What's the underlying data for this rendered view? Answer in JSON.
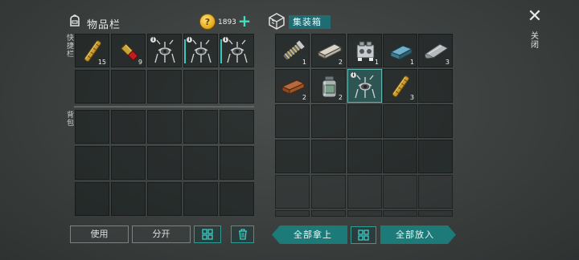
{
  "inventory": {
    "title": "物品栏",
    "coin_symbol": "?",
    "coins": "1893",
    "add_symbol": "+",
    "quick_label": "快捷栏",
    "bag_label": "背包",
    "quick_slots": [
      {
        "item": "bamboo-stick",
        "count": "15"
      },
      {
        "item": "shotgun-shell",
        "count": "9"
      },
      {
        "item": "bear-trap",
        "count": "",
        "badge": "i",
        "marked": false
      },
      {
        "item": "bear-trap",
        "count": "",
        "badge": "i",
        "marked": true
      },
      {
        "item": "bear-trap",
        "count": "",
        "badge": "i",
        "marked": true
      }
    ]
  },
  "container": {
    "title": "集装箱",
    "slots": [
      {
        "item": "spring-coil",
        "count": "1"
      },
      {
        "item": "wood-plank",
        "count": "2"
      },
      {
        "item": "engine-block",
        "count": "1"
      },
      {
        "item": "metal-ingot",
        "count": "1"
      },
      {
        "item": "metal-sheet",
        "count": "3"
      },
      {
        "item": "brick",
        "count": "2"
      },
      {
        "item": "glass-jar",
        "count": "2"
      },
      {
        "item": "bear-trap",
        "count": "",
        "badge": "i",
        "selected": true
      },
      {
        "item": "bamboo-stick",
        "count": "3"
      }
    ]
  },
  "close": {
    "label": "关闭",
    "symbol": "✕"
  },
  "buttons": {
    "use": "使用",
    "split": "分开",
    "take_all": "全部拿上",
    "put_all": "全部放入"
  },
  "colors": {
    "accent": "#1c7a78",
    "accent_light": "#3ad0c6"
  }
}
